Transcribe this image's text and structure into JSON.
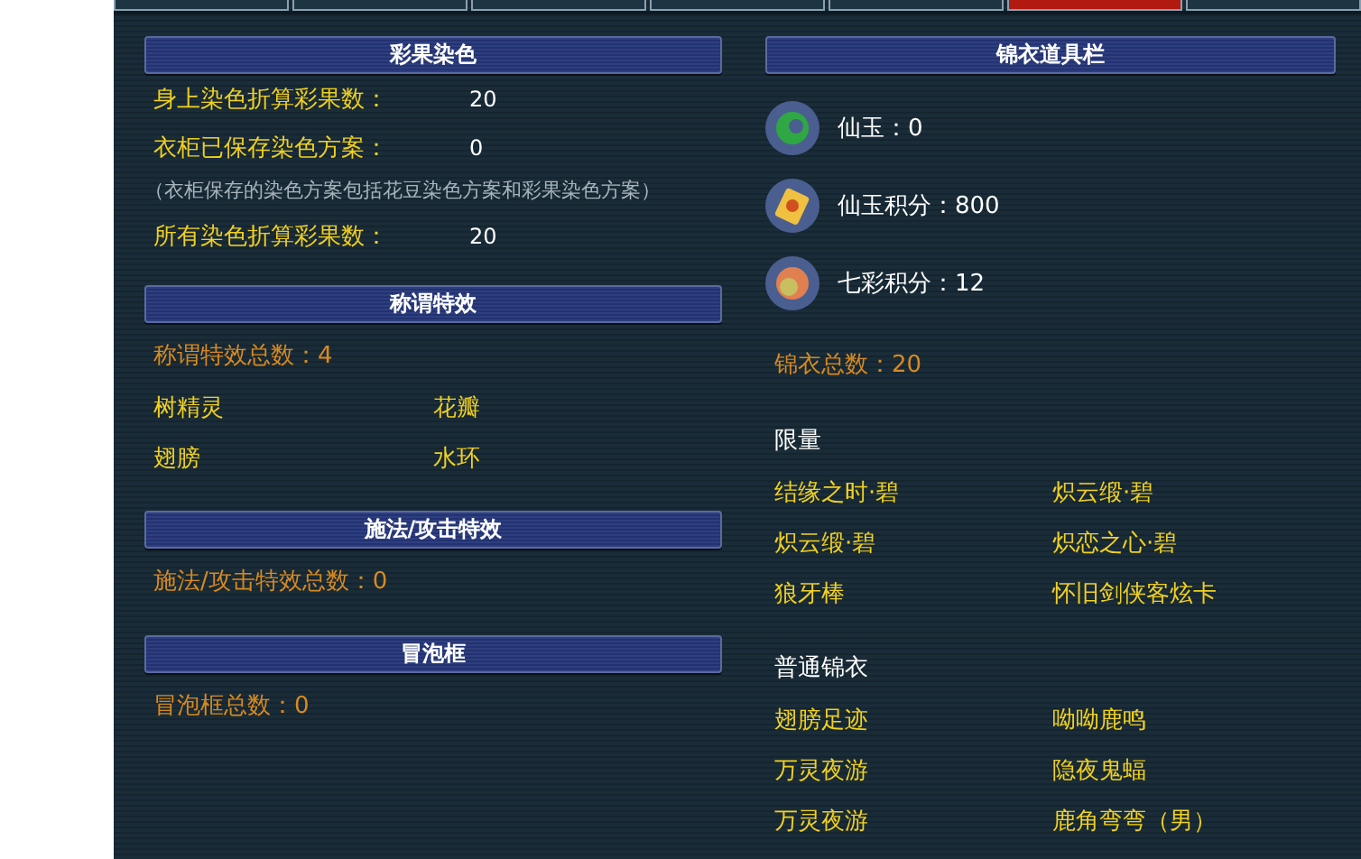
{
  "tabs": [
    {
      "selected": false
    },
    {
      "selected": false
    },
    {
      "selected": false
    },
    {
      "selected": false
    },
    {
      "selected": false
    },
    {
      "selected": true
    },
    {
      "selected": false
    }
  ],
  "left": [
    {
      "header": "彩果染色",
      "kind": "stats",
      "rows": [
        {
          "label": "身上染色折算彩果数：",
          "value": "20"
        },
        {
          "label": "衣柜已保存染色方案：",
          "value": "0"
        },
        {
          "note": "（衣柜保存的染色方案包括花豆染色方案和彩果染色方案）"
        },
        {
          "label": "所有染色折算彩果数：",
          "value": "20"
        }
      ]
    },
    {
      "header": "称谓特效",
      "kind": "list",
      "count": "称谓特效总数：4",
      "items": [
        "树精灵",
        "花瓣",
        "翅膀",
        "水环"
      ]
    },
    {
      "header": "施法/攻击特效",
      "kind": "list",
      "count": "施法/攻击特效总数：0"
    },
    {
      "header": "冒泡框",
      "kind": "list",
      "count": "冒泡框总数：0"
    }
  ],
  "right": {
    "header": "锦衣道具栏",
    "currencies": [
      {
        "kind": "jade",
        "text": "仙玉：0"
      },
      {
        "kind": "card",
        "text": "仙玉积分：800"
      },
      {
        "kind": "orb",
        "text": "七彩积分：12"
      }
    ],
    "count": "锦衣总数：20",
    "groups": [
      {
        "title": "限量",
        "items": [
          "结缘之时·碧",
          "炽云缎·碧",
          "炽云缎·碧",
          "炽恋之心·碧",
          "狼牙棒",
          "怀旧剑侠客炫卡"
        ]
      },
      {
        "title": "普通锦衣",
        "items": [
          "翅膀足迹",
          "呦呦鹿鸣",
          "万灵夜游",
          "隐夜鬼蝠",
          "万灵夜游",
          "鹿角弯弯（男）"
        ]
      }
    ]
  }
}
